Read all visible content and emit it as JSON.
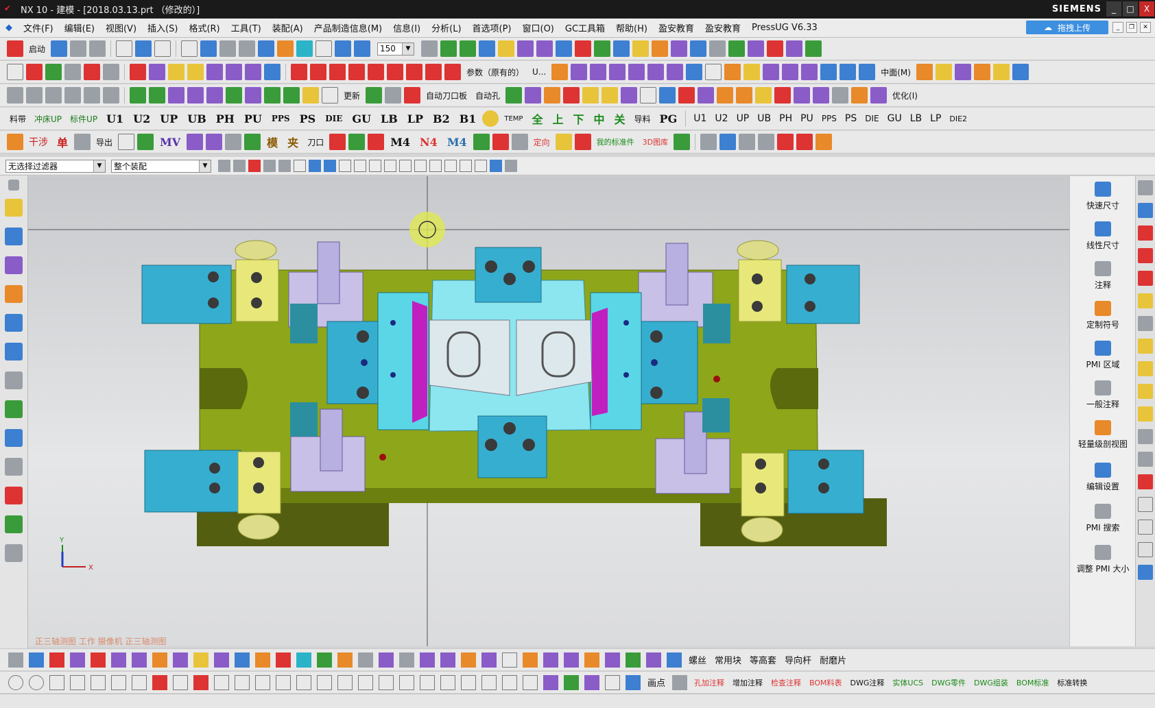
{
  "window": {
    "title": "NX 10 - 建模 - [2018.03.13.prt （修改的）]",
    "brand": "SIEMENS",
    "minimize": "_",
    "maximize": "□",
    "close": "X"
  },
  "menu": {
    "items": [
      "文件(F)",
      "编辑(E)",
      "视图(V)",
      "插入(S)",
      "格式(R)",
      "工具(T)",
      "装配(A)",
      "产品制造信息(M)",
      "信息(I)",
      "分析(L)",
      "首选项(P)",
      "窗口(O)",
      "GC工具箱",
      "帮助(H)",
      "盈安教育",
      "盈安教育",
      "PressUG V6.33"
    ],
    "upload_button": "拖拽上传"
  },
  "toolbar1": {
    "start_label": "启动",
    "zoom_value": "150"
  },
  "toolbar2": {
    "param_label": "参数（原有的）",
    "u_label": "U...",
    "midplane_label": "中面(M)"
  },
  "toolbar3": {
    "cutter_label": "自动刀口板",
    "hole_label": "自动孔",
    "optimize_label": "优化(I)",
    "update_label": "更新"
  },
  "toolbar4": {
    "labels": [
      "料带",
      "冲床UP",
      "标件UP",
      "U1",
      "U2",
      "UP",
      "UB",
      "PH",
      "PU",
      "PPS",
      "PS",
      "DIE",
      "GU",
      "LB",
      "LP",
      "B2",
      "B1"
    ],
    "special": [
      "TEMP",
      "全",
      "上",
      "下",
      "中",
      "关",
      "导料",
      "PG"
    ],
    "right_labels": [
      "U1",
      "U2",
      "UP",
      "UB",
      "PH",
      "PU",
      "PPS",
      "PS",
      "DIE",
      "GU",
      "LB",
      "LP",
      "DIE2"
    ]
  },
  "toolbar5": {
    "labels": [
      "干涉",
      "单",
      "导出",
      "MV",
      "模",
      "夹",
      "刀口",
      "M4",
      "N4",
      "M4",
      "定向",
      "我的标准件",
      "3D图库"
    ]
  },
  "selection": {
    "filter_value": "无选择过滤器",
    "assembly_value": "整个装配"
  },
  "viewport": {
    "view_label": "正三轴测图 工作 摄像机 正三轴测图",
    "axis_x": "X",
    "axis_y": "Y"
  },
  "right_panel": {
    "items": [
      "快速尺寸",
      "线性尺寸",
      "注释",
      "定制符号",
      "PMI 区域",
      "一般注释",
      "轻量级剖视图",
      "编辑设置",
      "PMI 搜索",
      "调整 PMI 大小"
    ]
  },
  "bottom_toolbar": {
    "labels": [
      "螺丝",
      "常用块",
      "等高套",
      "导向杆",
      "耐磨片"
    ],
    "labels2": [
      "画点",
      "孔加注释",
      "增加注释",
      "检查注释",
      "BOM料表",
      "DWG注释",
      "实体UCS",
      "DWG零件",
      "DWG组装",
      "BOM标准",
      "标准转换"
    ]
  }
}
